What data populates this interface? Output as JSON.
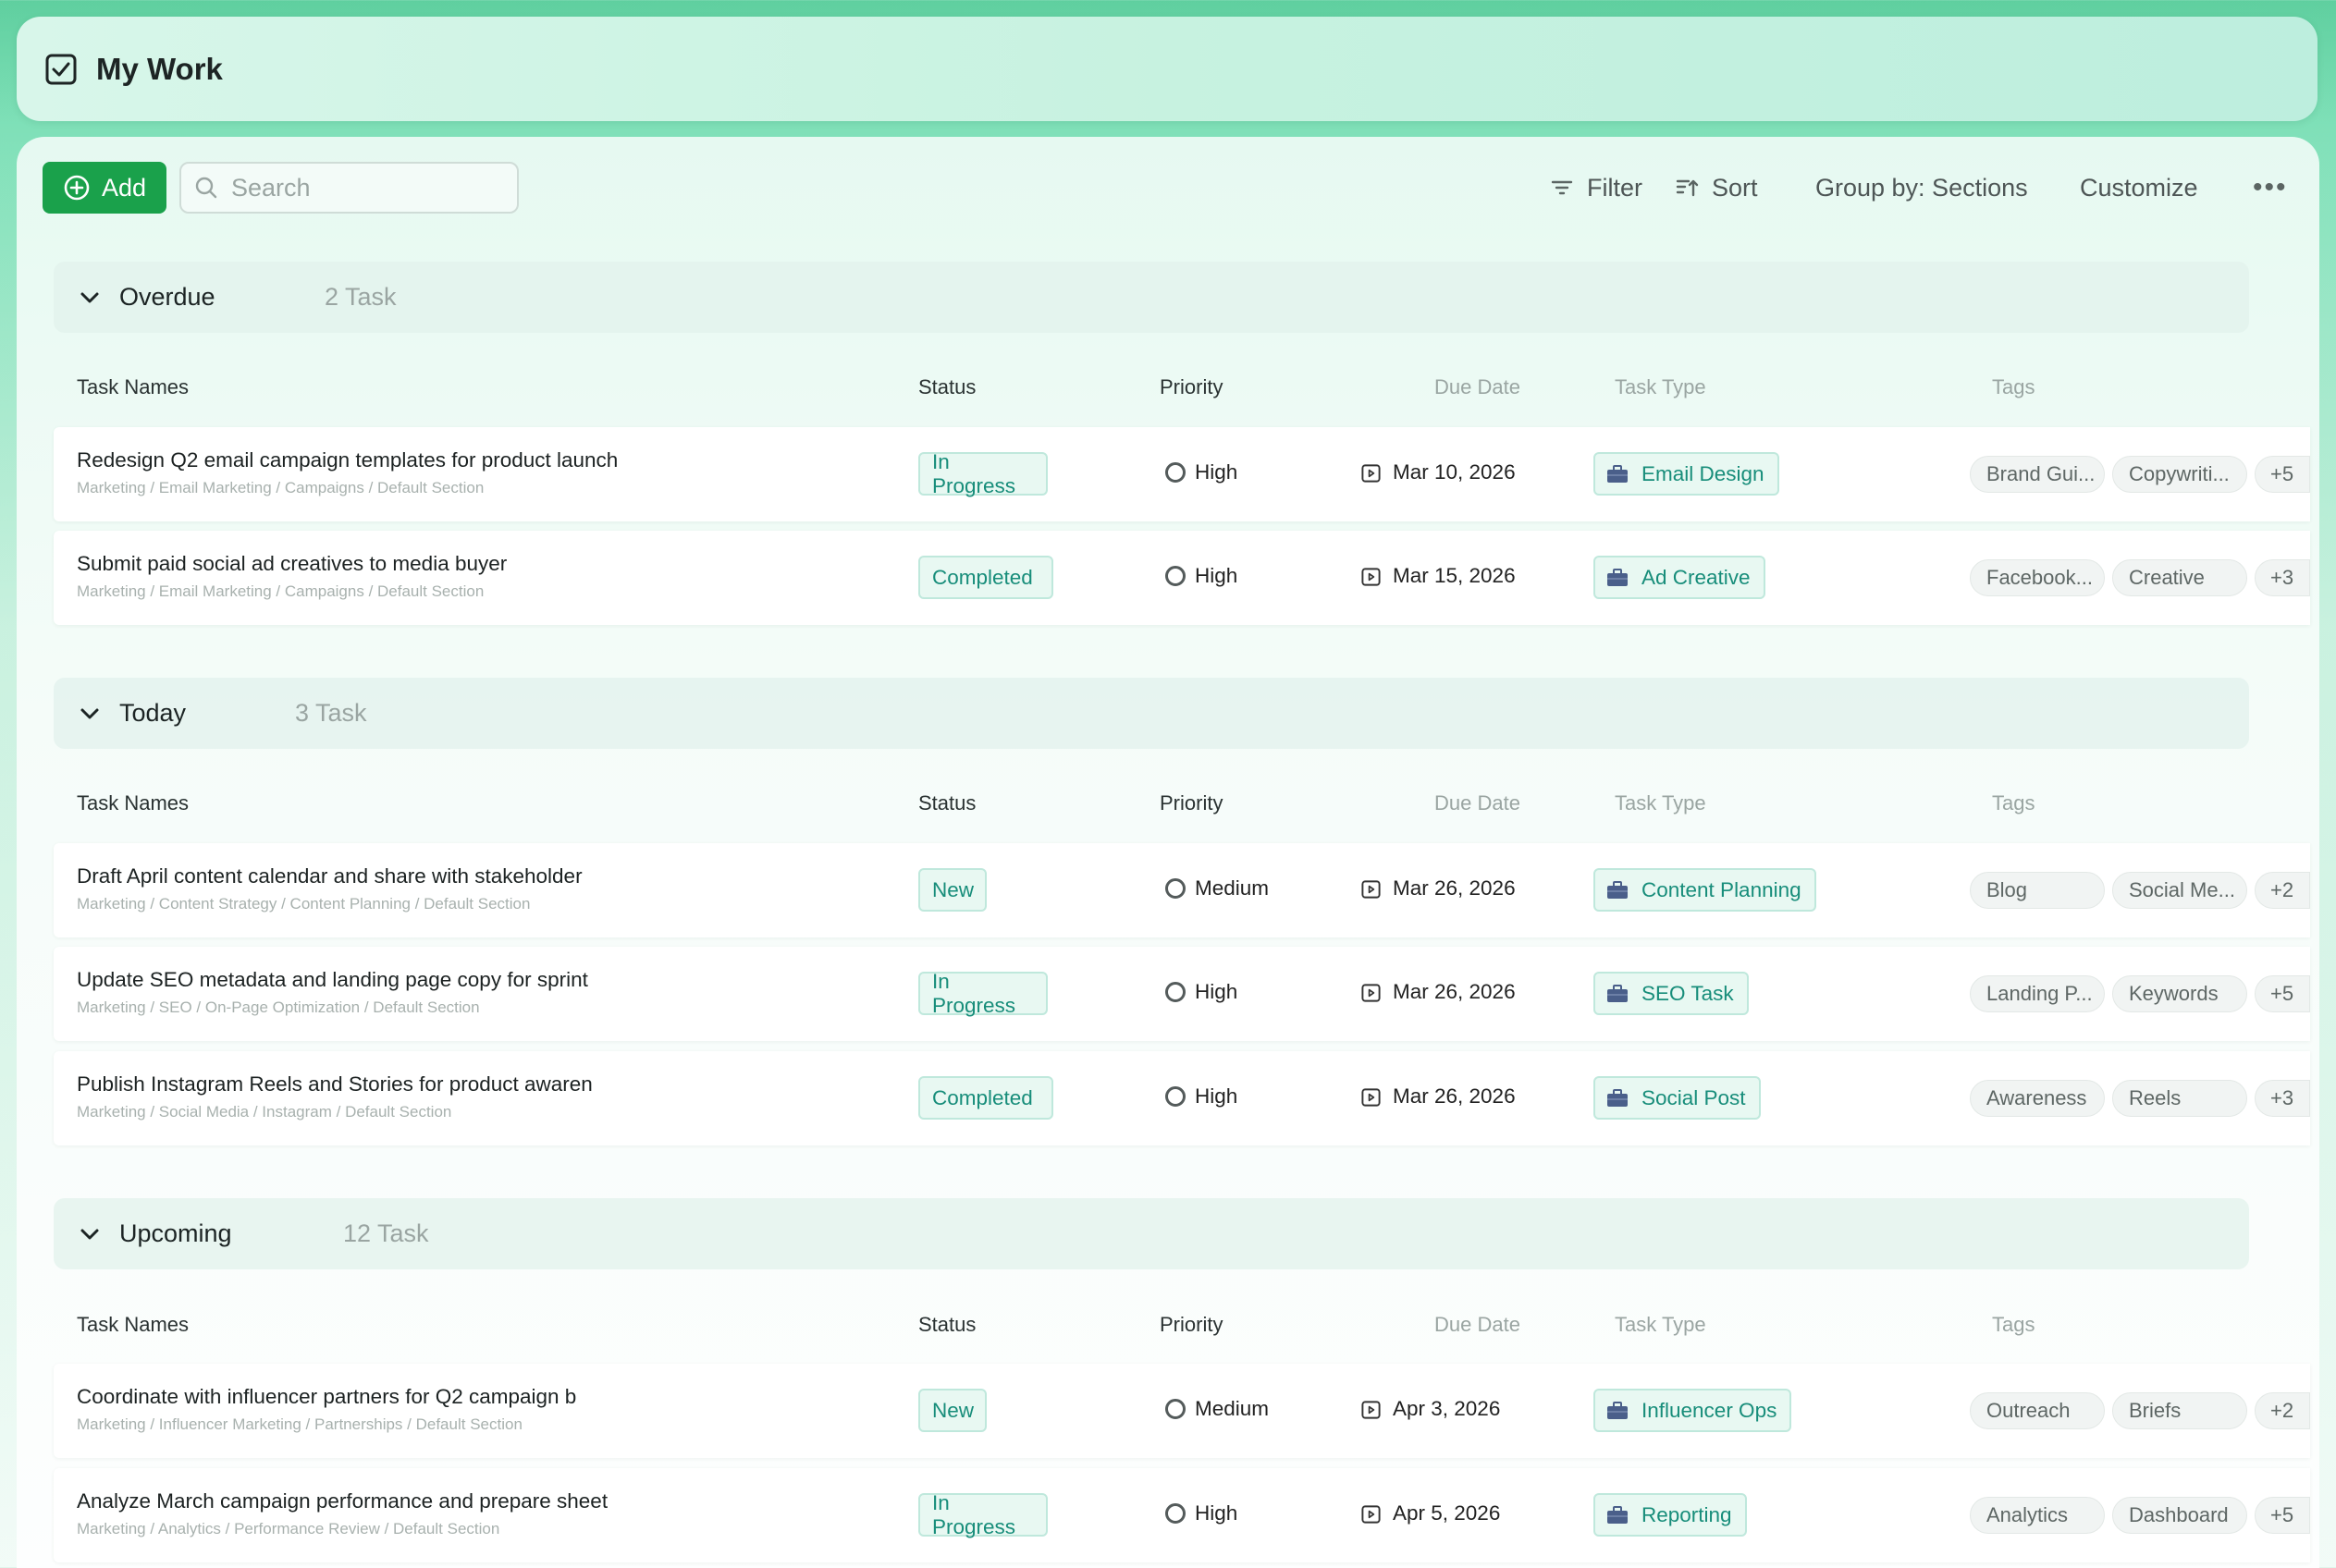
{
  "header": {
    "title": "My Work",
    "icon": "checkbox-icon"
  },
  "toolbar": {
    "add_label": "Add",
    "search_placeholder": "Search",
    "filter_label": "Filter",
    "sort_label": "Sort",
    "group_label": "Group by: Sections",
    "customize_label": "Customize",
    "more_label": "•••"
  },
  "columns": {
    "name": "Task Names",
    "status": "Status",
    "priority": "Priority",
    "due": "Due Date",
    "type": "Task Type",
    "tags": "Tags"
  },
  "sections": [
    {
      "name": "Overdue",
      "count": "2 Task",
      "rows": [
        {
          "name": "Redesign Q2 email campaign templates for product launch",
          "path": "Marketing / Email Marketing / Campaigns / Default Section",
          "status": "In Progress",
          "priority": "High",
          "due": "Mar 10, 2026",
          "type": "Email Design",
          "tag1": "Brand Gui...",
          "tag2": "Copywriti...",
          "more": "+5"
        },
        {
          "name": "Submit paid social ad creatives to media buyer",
          "path": "Marketing / Email Marketing / Campaigns / Default Section",
          "status": "Completed",
          "priority": "High",
          "due": "Mar 15, 2026",
          "type": "Ad Creative",
          "tag1": "Facebook...",
          "tag2": "Creative",
          "more": "+3"
        }
      ]
    },
    {
      "name": "Today",
      "count": "3 Task",
      "rows": [
        {
          "name": "Draft April content calendar and share with stakeholder",
          "path": "Marketing / Content Strategy / Content Planning / Default Section",
          "status": "New",
          "priority": "Medium",
          "due": "Mar 26, 2026",
          "type": "Content Planning",
          "tag1": "Blog",
          "tag2": "Social Me...",
          "more": "+2"
        },
        {
          "name": "Update SEO metadata and landing page copy for sprint",
          "path": "Marketing / SEO / On-Page Optimization / Default Section",
          "status": "In Progress",
          "priority": "High",
          "due": "Mar 26, 2026",
          "type": "SEO Task",
          "tag1": "Landing P...",
          "tag2": "Keywords",
          "more": "+5"
        },
        {
          "name": "Publish Instagram Reels and Stories for product awaren",
          "path": "Marketing / Social Media / Instagram / Default Section",
          "status": "Completed",
          "priority": "High",
          "due": "Mar 26, 2026",
          "type": "Social Post",
          "tag1": "Awareness",
          "tag2": "Reels",
          "more": "+3"
        }
      ]
    },
    {
      "name": "Upcoming",
      "count": "12 Task",
      "rows": [
        {
          "name": "Coordinate with influencer partners for Q2 campaign b",
          "path": "Marketing / Influencer Marketing / Partnerships / Default Section",
          "status": "New",
          "priority": "Medium",
          "due": "Apr 3, 2026",
          "type": "Influencer Ops",
          "tag1": "Outreach",
          "tag2": "Briefs",
          "more": "+2"
        },
        {
          "name": "Analyze March campaign performance and prepare sheet",
          "path": "Marketing / Analytics / Performance Review / Default Section",
          "status": "In Progress",
          "priority": "High",
          "due": "Apr 5, 2026",
          "type": "Reporting",
          "tag1": "Analytics",
          "tag2": "Dashboard",
          "more": "+5"
        }
      ]
    }
  ]
}
